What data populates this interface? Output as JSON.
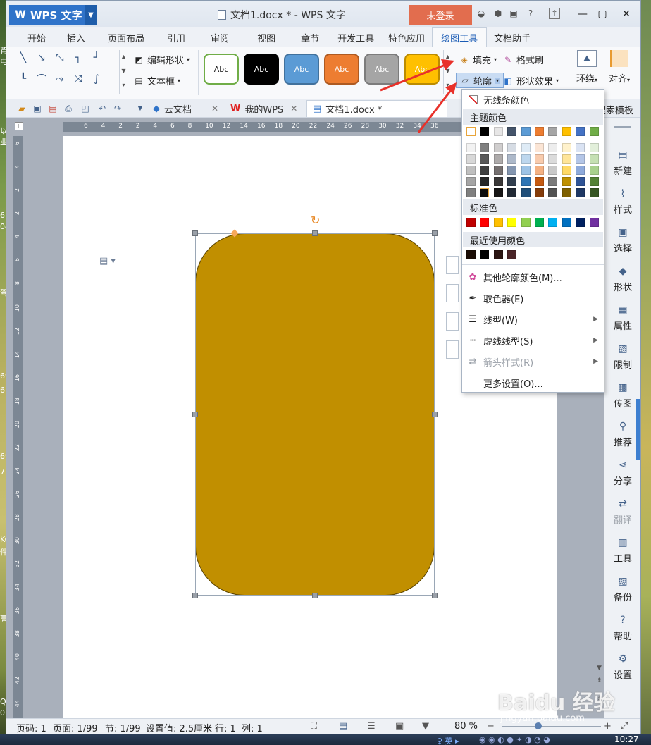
{
  "desktop_fragments": [
    "背",
    "电",
    "以",
    "业",
    "6b",
    "04",
    "驾",
    "69",
    "6",
    "69",
    "7",
    "KC",
    "件",
    "高",
    "QQ",
    "01"
  ],
  "titlebar": {
    "app_name": "WPS 文字",
    "doc_title": "文档1.docx * - WPS 文字",
    "login_label": "未登录"
  },
  "tabs": [
    "开始",
    "插入",
    "页面布局",
    "引用",
    "审阅",
    "视图",
    "章节",
    "开发工具",
    "特色应用",
    "绘图工具",
    "文档助手"
  ],
  "active_tab": "绘图工具",
  "ribbon": {
    "edit_shape": "编辑形状",
    "text_box": "文本框",
    "style_label": "Abc",
    "fill": "填充",
    "format_brush": "格式刷",
    "outline": "轮廓",
    "shape_effect": "形状效果",
    "wrap": "环绕",
    "align": "对齐",
    "style_colors": [
      "#ffffff",
      "#000000",
      "#5b9bd5",
      "#ed7d31",
      "#a5a5a5",
      "#ffc000"
    ],
    "style_borders": [
      "#70ad47",
      "#000000",
      "#41719c",
      "#ae5a21",
      "#7c7c7c",
      "#bc8c00"
    ]
  },
  "qbar": {
    "cloud_docs": "云文档",
    "my_wps": "我的WPS",
    "doc_tab": "文档1.docx *",
    "search_template": "搜索模板"
  },
  "ruler": {
    "top": [
      "6",
      "4",
      "2",
      "2",
      "4",
      "6",
      "8",
      "10",
      "12",
      "14",
      "16",
      "18",
      "20",
      "22",
      "24",
      "26",
      "28",
      "30",
      "32",
      "34",
      "36"
    ],
    "left": [
      "6",
      "4",
      "2",
      "2",
      "4",
      "6",
      "8",
      "10",
      "12",
      "14",
      "16",
      "18",
      "20",
      "22",
      "24",
      "26",
      "28",
      "30",
      "32",
      "34",
      "36",
      "38",
      "40",
      "42",
      "44"
    ],
    "corner": "L"
  },
  "shape": {
    "fill": "#c18f00",
    "border": "#5a4300"
  },
  "dropdown": {
    "no_line": "无线条颜色",
    "theme_colors": "主题颜色",
    "standard_colors": "标准色",
    "recent_colors": "最近使用颜色",
    "more_outline_colors": "其他轮廓颜色(M)...",
    "eyedropper": "取色器(E)",
    "line_type": "线型(W)",
    "dash_type": "虚线线型(S)",
    "arrow_style": "箭头样式(R)",
    "more_settings": "更多设置(O)...",
    "theme_top": [
      "#ffffff",
      "#000000",
      "#e7e6e6",
      "#44546a",
      "#5b9bd5",
      "#ed7d31",
      "#a5a5a5",
      "#ffc000",
      "#4472c4",
      "#70ad47"
    ],
    "theme_shades": [
      [
        "#f2f2f2",
        "#7f7f7f",
        "#d0cece",
        "#d6dce4",
        "#deebf6",
        "#fbe5d5",
        "#ededed",
        "#fff2cc",
        "#dae3f3",
        "#e2efda"
      ],
      [
        "#d8d8d8",
        "#595959",
        "#aeabab",
        "#adb9ca",
        "#bdd7ee",
        "#f8cbad",
        "#dbdbdb",
        "#ffe599",
        "#b4c6e7",
        "#c5e0b3"
      ],
      [
        "#bfbfbf",
        "#3f3f3f",
        "#757070",
        "#8496b0",
        "#9dc3e6",
        "#f4b183",
        "#c9c9c9",
        "#ffd966",
        "#8eaadb",
        "#a8d08d"
      ],
      [
        "#a5a5a5",
        "#262626",
        "#3a3838",
        "#323f4f",
        "#2e75b5",
        "#c55a11",
        "#7b7b7b",
        "#bf9000",
        "#2f5496",
        "#538135"
      ],
      [
        "#7f7f7f",
        "#0c0c0c",
        "#171616",
        "#222a35",
        "#1f4e79",
        "#843c0b",
        "#525252",
        "#7f6000",
        "#1f3864",
        "#375623"
      ]
    ],
    "standard": [
      "#c00000",
      "#ff0000",
      "#ffc000",
      "#ffff00",
      "#92d050",
      "#00b050",
      "#00b0f0",
      "#0070c0",
      "#002060",
      "#7030a0"
    ],
    "recent": [
      "#1b0c05",
      "#000000",
      "#2b1512",
      "#4a2427"
    ]
  },
  "sidebar": [
    "新建",
    "样式",
    "选择",
    "形状",
    "属性",
    "限制",
    "传图",
    "推荐",
    "分享",
    "翻译",
    "工具",
    "备份",
    "帮助",
    "设置"
  ],
  "status": {
    "page_code": "页码: 1",
    "page": "页面: 1/99",
    "section": "节: 1/99",
    "setting": "设置值: 2.5厘米",
    "row": "行: 1",
    "col": "列: 1",
    "zoom": "80 %"
  },
  "taskbar_time": "10:27",
  "watermark": {
    "text": "Baidu 经验",
    "url": "jingyan.baidu.com"
  },
  "accent_colors": {
    "wps_blue": "#2f73c9",
    "login_orange": "#e26d4e",
    "arrow_red": "#e8312a"
  }
}
